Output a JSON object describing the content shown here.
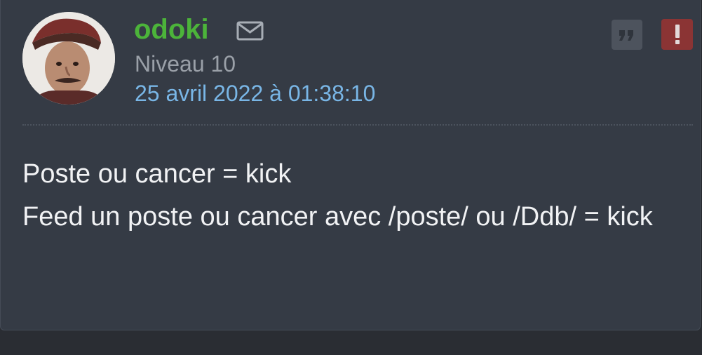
{
  "author": {
    "username": "odoki",
    "level": "Niveau 10",
    "avatar": "avatar-image"
  },
  "post": {
    "date": "25 avril 2022 à 01:38:10",
    "lines": [
      "Poste ou cancer = kick",
      "Feed un poste ou cancer avec /poste/ ou /Ddb/ = kick"
    ]
  },
  "actions": {
    "message_icon": "envelope-icon",
    "quote_icon": "quote-icon",
    "report_icon": "exclamation-icon"
  },
  "colors": {
    "background": "#2a2d33",
    "card": "#353b45",
    "username": "#4cb43a",
    "level": "#9aa0a8",
    "date": "#79b6e6",
    "text": "#f1f2f4",
    "quote_button": "#4d535d",
    "report_button": "#8b3434"
  }
}
